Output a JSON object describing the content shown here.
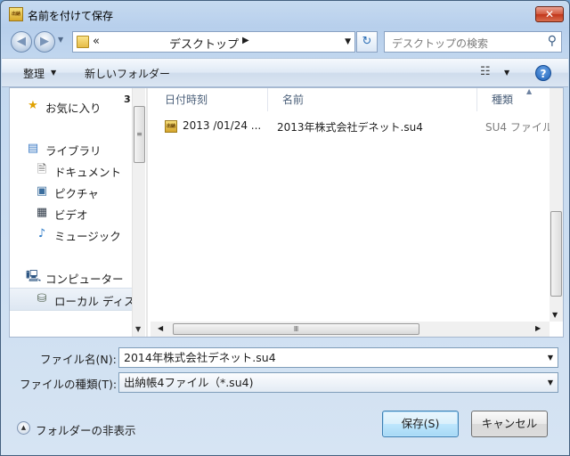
{
  "window": {
    "title": "名前を付けて保存",
    "app_icon_text": "出納",
    "close_glyph": "✕"
  },
  "address_bar": {
    "back_glyph": "◀",
    "forward_glyph": "▶",
    "chevrons": "«",
    "location": "デスクトップ",
    "location_arrow": "▶",
    "dropdown_glyph": "▼",
    "refresh_glyph": "↻"
  },
  "search": {
    "placeholder": "デスクトップの検索",
    "icon": "search-icon",
    "icon_glyph": "⚲"
  },
  "toolbar": {
    "organize_label": "整理",
    "organize_arrow": "▼",
    "new_folder_label": "新しいフォルダー",
    "view_glyph": "☷",
    "view_arrow": "▼",
    "help_glyph": "?"
  },
  "nav_pane": {
    "favorites": {
      "label": "お気に入り",
      "icon": "star-icon",
      "glyph": "★",
      "count": "3"
    },
    "libraries": {
      "label": "ライブラリ",
      "icon": "library-icon",
      "glyph": "▤"
    },
    "library_items": [
      {
        "label": "ドキュメント",
        "icon": "document-icon",
        "glyph": "🗎"
      },
      {
        "label": "ピクチャ",
        "icon": "picture-icon",
        "glyph": "▣"
      },
      {
        "label": "ビデオ",
        "icon": "video-icon",
        "glyph": "▦"
      },
      {
        "label": "ミュージック",
        "icon": "music-icon",
        "glyph": "♪"
      }
    ],
    "computer": {
      "label": "コンピューター",
      "icon": "computer-icon",
      "glyph": "🖳"
    },
    "local_disk": {
      "label": "ローカル ディス",
      "icon": "local-disk-icon",
      "glyph": "⛁"
    }
  },
  "file_list": {
    "columns": [
      "日付時刻",
      "名前",
      "種類"
    ],
    "sort_glyph": "▲",
    "rows": [
      {
        "date": "2013 /01/24 ...",
        "name": "2013年株式会社デネット.su4",
        "type": "SU4 ファイル",
        "icon_text": "出納"
      }
    ]
  },
  "scrollbars": {
    "grip": "≡",
    "hgrip": "Ⅲ",
    "up": "▲",
    "down": "▼",
    "left": "◀",
    "right": "▶"
  },
  "form": {
    "filename_label": "ファイル名(N):",
    "filename_value": "2014年株式会社デネット.su4",
    "filetype_label": "ファイルの種類(T):",
    "filetype_value": "出納帳4ファイル（*.su4)"
  },
  "footer": {
    "hide_folders_label": "フォルダーの非表示",
    "hide_arrow": "▲",
    "save_label": "保存(S)",
    "cancel_label": "キャンセル"
  }
}
